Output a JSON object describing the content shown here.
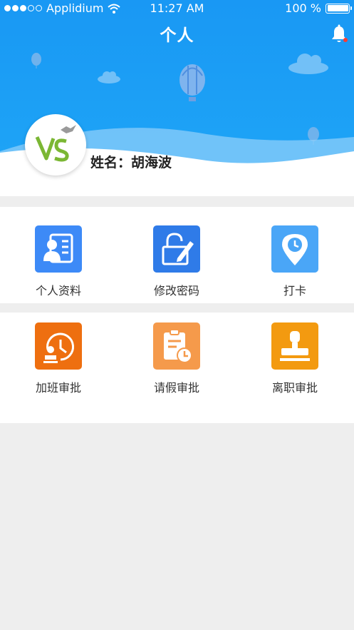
{
  "status_bar": {
    "carrier": "Applidium",
    "time": "11:27 AM",
    "battery": "100 %"
  },
  "header": {
    "title": "个人",
    "notification_badge_color": "#ff3b30"
  },
  "profile": {
    "name_label": "姓名：胡海波"
  },
  "menu": {
    "items": [
      {
        "label": "个人资料",
        "icon": "profile-card-icon",
        "color": "#3d8af7"
      },
      {
        "label": "修改密码",
        "icon": "lock-edit-icon",
        "color": "#2f7be8"
      },
      {
        "label": "打卡",
        "icon": "location-clock-icon",
        "color": "#4aa6f7"
      },
      {
        "label": "加班审批",
        "icon": "overtime-approval-icon",
        "color": "#ee6f10"
      },
      {
        "label": "请假审批",
        "icon": "leave-approval-icon",
        "color": "#f59a4b"
      },
      {
        "label": "离职审批",
        "icon": "stamp-approval-icon",
        "color": "#f39a10"
      }
    ]
  },
  "colors": {
    "header_blue": "#1d9af5",
    "background_gray": "#eeeeee"
  }
}
